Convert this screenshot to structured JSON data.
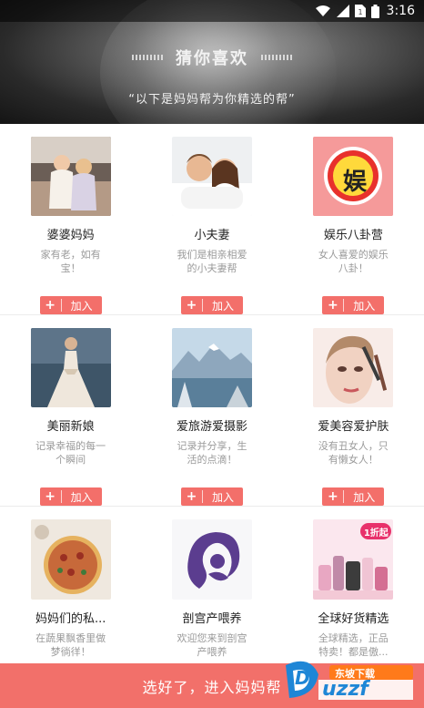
{
  "status_bar": {
    "time": "3:16",
    "icons": [
      "wifi-icon",
      "signal-icon",
      "sim-icon",
      "battery-icon"
    ]
  },
  "hero": {
    "title": "猜你喜欢",
    "subtitle": "“以下是妈妈帮为你精选的帮”"
  },
  "join_label": "加入",
  "groups": [
    {
      "name": "婆婆妈妈",
      "desc": "家有老，如有宝！"
    },
    {
      "name": "小夫妻",
      "desc": "我们是相亲相爱的小夫妻帮"
    },
    {
      "name": "娱乐八卦营",
      "desc": "女人喜爱的娱乐八卦！",
      "badge": "娱"
    },
    {
      "name": "美丽新娘",
      "desc": "记录幸福的每一个瞬间"
    },
    {
      "name": "爱旅游爱摄影",
      "desc": "记录并分享，生活的点滴！"
    },
    {
      "name": "爱美容爱护肤",
      "desc": "没有丑女人，只有懒女人！"
    },
    {
      "name": "妈妈们的私...",
      "desc": "在蔬果飘香里做梦徜徉！"
    },
    {
      "name": "剖宫产喂养",
      "desc": "欢迎您来到剖宫产喂养"
    },
    {
      "name": "全球好货精选",
      "desc": "全球精选，正品特卖！都是傲...",
      "tag": "1折起"
    }
  ],
  "bottom": {
    "label": "选好了，进入妈妈帮"
  },
  "watermark": {
    "site": "uzzf",
    "cn": "东坡下载",
    "prefix": "D"
  },
  "colors": {
    "accent": "#f36f6a"
  }
}
